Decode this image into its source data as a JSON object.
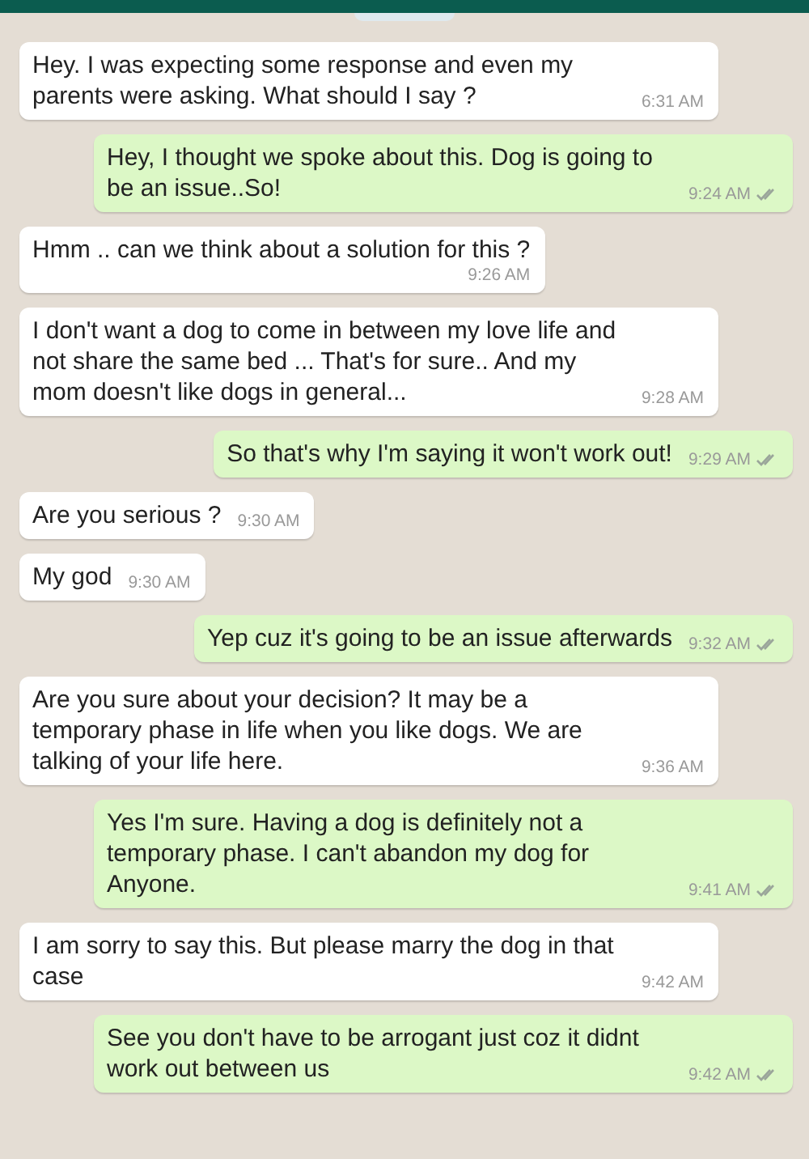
{
  "messages": [
    {
      "kind": "incoming",
      "text": "Hey. I was expecting some response and even my parents were asking. What should I say ?",
      "time": "6:31 AM"
    },
    {
      "kind": "outgoing",
      "text": "Hey, I thought we spoke about this. Dog is going to be an issue..So!",
      "time": "9:24 AM"
    },
    {
      "kind": "incoming",
      "text": "Hmm .. can we think about a solution for this ?",
      "time": "9:26 AM",
      "time_below": true
    },
    {
      "kind": "incoming",
      "text": "I don't want a dog to come in between my love life and not share the same bed ... That's for sure.. And my mom doesn't like dogs in general...",
      "time": "9:28 AM"
    },
    {
      "kind": "outgoing",
      "text": "So that's why I'm saying it won't work out!",
      "time": "9:29 AM"
    },
    {
      "kind": "incoming",
      "text": "Are you serious ?",
      "time": "9:30 AM"
    },
    {
      "kind": "incoming",
      "text": "My god",
      "time": "9:30 AM"
    },
    {
      "kind": "outgoing",
      "text": "Yep cuz it's going to be an issue afterwards",
      "time": "9:32 AM"
    },
    {
      "kind": "incoming",
      "text": "Are you sure about your decision? It may be a temporary phase in life when you like dogs. We are talking of your life here.",
      "time": "9:36 AM"
    },
    {
      "kind": "outgoing",
      "text": "Yes I'm sure. Having a dog is definitely not a temporary phase. I can't abandon my dog for Anyone.",
      "time": "9:41 AM"
    },
    {
      "kind": "incoming",
      "text": "I am sorry to say this. But please marry the dog in that case",
      "time": "9:42 AM"
    },
    {
      "kind": "outgoing",
      "text": "See you don't have to be arrogant just coz it didnt work out between us",
      "time": "9:42 AM"
    }
  ]
}
